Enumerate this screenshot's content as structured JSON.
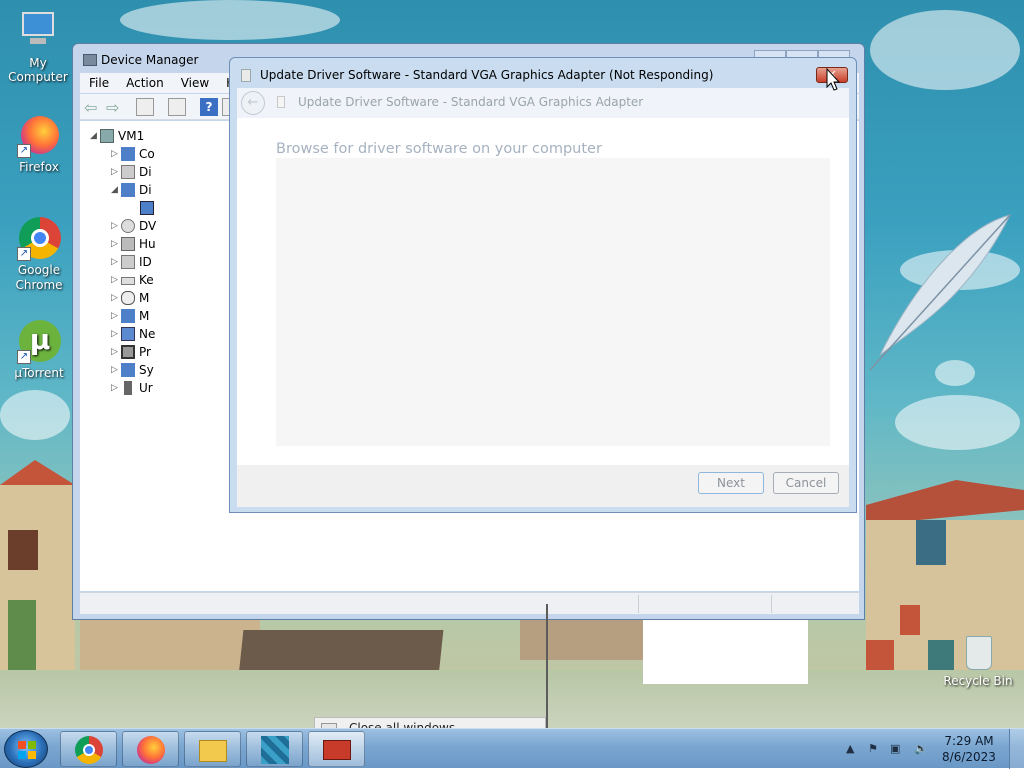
{
  "desktop": {
    "icons": [
      {
        "label": "My Computer",
        "icon": "computer-icon"
      },
      {
        "label": "Firefox",
        "icon": "firefox-icon"
      },
      {
        "label": "Google Chrome",
        "icon": "chrome-icon"
      },
      {
        "label": "µTorrent",
        "icon": "utorrent-icon"
      },
      {
        "label": "Recycle Bin",
        "icon": "recycle-bin-icon"
      }
    ]
  },
  "device_manager": {
    "title": "Device Manager",
    "menu": [
      "File",
      "Action",
      "View",
      "He"
    ],
    "tree": {
      "root": "VM1",
      "items": [
        {
          "label": "Co",
          "expanded": false
        },
        {
          "label": "Di",
          "expanded": false
        },
        {
          "label": "Di",
          "expanded": true
        },
        {
          "label": "DV",
          "expanded": false
        },
        {
          "label": "Hu",
          "expanded": false
        },
        {
          "label": "ID",
          "expanded": false
        },
        {
          "label": "Ke",
          "expanded": false
        },
        {
          "label": "M",
          "expanded": false
        },
        {
          "label": "M",
          "expanded": false
        },
        {
          "label": "Ne",
          "expanded": false
        },
        {
          "label": "Pr",
          "expanded": false
        },
        {
          "label": "Sy",
          "expanded": false
        },
        {
          "label": "Ur",
          "expanded": false
        }
      ]
    }
  },
  "dialog": {
    "title": "Update Driver Software - Standard VGA Graphics Adapter (Not Responding)",
    "header_title": "Update Driver Software - Standard VGA Graphics Adapter",
    "heading": "Browse for driver software on your computer",
    "next_label": "Next",
    "cancel_label": "Cancel",
    "close_label": "✕"
  },
  "preview_menu": {
    "label": "Close all windows"
  },
  "taskbar": {
    "items": [
      "chrome-icon",
      "firefox-icon",
      "explorer-icon",
      "registry-icon",
      "toolbox-icon"
    ],
    "clock": {
      "time": "7:29 AM",
      "date": "8/6/2023"
    }
  }
}
